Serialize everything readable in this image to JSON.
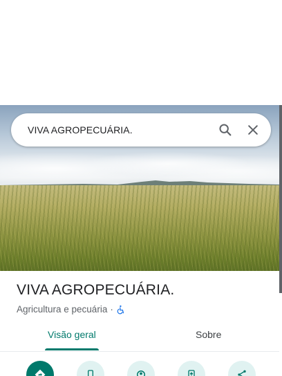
{
  "search": {
    "query": "VIVA AGROPECUÁRIA."
  },
  "place": {
    "name": "VIVA AGROPECUÁRIA.",
    "category": "Agricultura e pecuária",
    "separator": "·"
  },
  "tabs": [
    {
      "label": "Visão geral",
      "active": true
    },
    {
      "label": "Sobre",
      "active": false
    }
  ],
  "actions": [
    {
      "icon": "directions-icon"
    },
    {
      "icon": "phone-icon"
    },
    {
      "icon": "nearby-icon"
    },
    {
      "icon": "send-to-phone-icon"
    },
    {
      "icon": "share-icon"
    }
  ],
  "colors": {
    "accent": "#00796b",
    "accent_light": "#e0f2f1",
    "accessible_icon": "#1a73e8"
  }
}
